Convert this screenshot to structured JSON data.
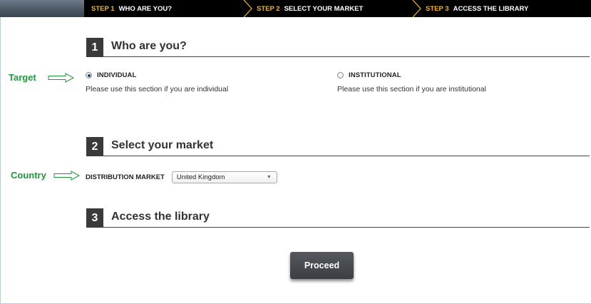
{
  "steps": [
    {
      "num": "STEP 1",
      "label": "WHO ARE YOU?"
    },
    {
      "num": "STEP 2",
      "label": "SELECT YOUR MARKET"
    },
    {
      "num": "STEP 3",
      "label": "ACCESS THE LIBRARY"
    }
  ],
  "sections": [
    {
      "num": "1",
      "title": "Who are you?"
    },
    {
      "num": "2",
      "title": "Select your market"
    },
    {
      "num": "3",
      "title": "Access the library"
    }
  ],
  "annotations": {
    "target": "Target",
    "country": "Country"
  },
  "investor_type": {
    "options": [
      {
        "label": "INDIVIDUAL",
        "description": "Please use this section if you are individual",
        "selected": true
      },
      {
        "label": "INSTITUTIONAL",
        "description": "Please use this section if you are institutional",
        "selected": false
      }
    ]
  },
  "market": {
    "label": "DISTRIBUTION MARKET",
    "selected": "United Kingdom"
  },
  "proceed_label": "Proceed",
  "colors": {
    "step_number": "#f2b705",
    "annotation": "#1f9a3a",
    "badge": "#3a3a3a"
  }
}
